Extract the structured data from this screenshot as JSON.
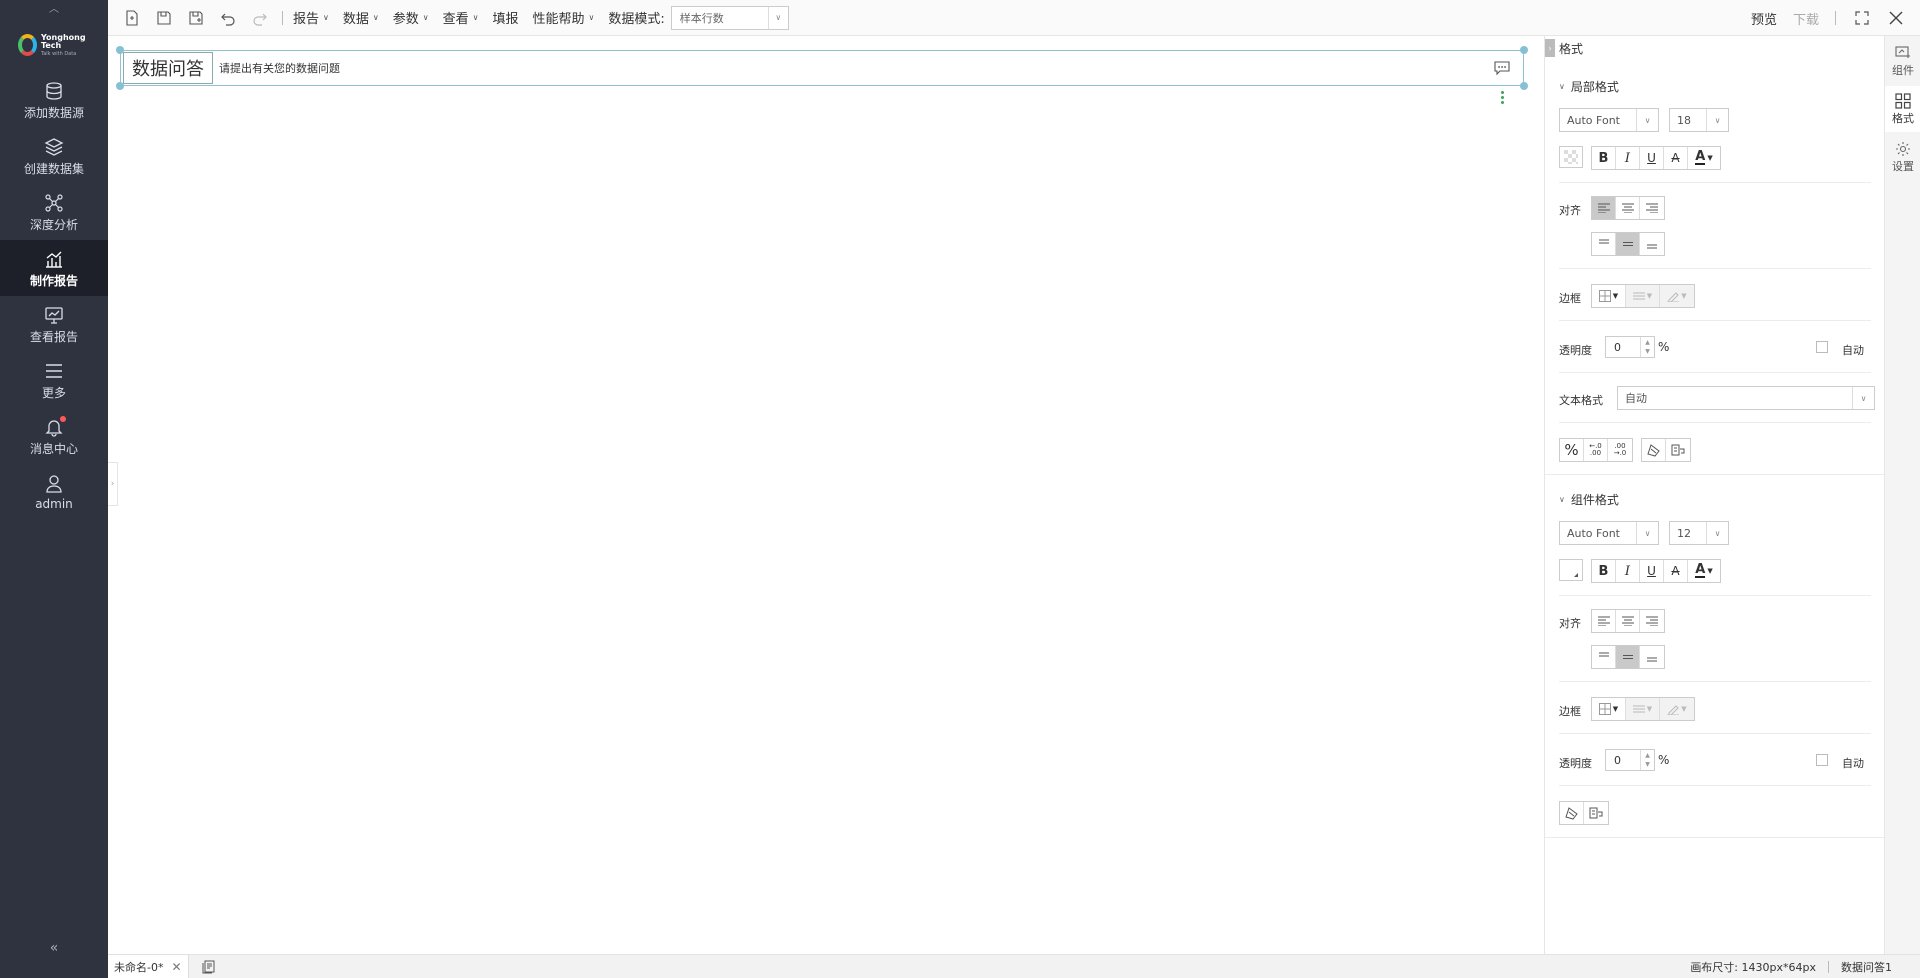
{
  "nav": {
    "brand_name": "Yonghong Tech",
    "brand_tagline": "Talk with Data",
    "items": [
      {
        "label": "添加数据源",
        "icon": "database-icon"
      },
      {
        "label": "创建数据集",
        "icon": "layers-icon"
      },
      {
        "label": "深度分析",
        "icon": "network-icon"
      },
      {
        "label": "制作报告",
        "icon": "bar-chart-icon"
      },
      {
        "label": "查看报告",
        "icon": "monitor-chart-icon"
      },
      {
        "label": "更多",
        "icon": "menu-icon"
      },
      {
        "label": "消息中心",
        "icon": "bell-icon"
      },
      {
        "label": "admin",
        "icon": "user-icon"
      }
    ],
    "active_index": 3
  },
  "toolbar": {
    "menus": [
      "报告",
      "数据",
      "参数",
      "查看"
    ],
    "fill_label": "填报",
    "perf_help": "性能帮助",
    "data_mode_label": "数据模式:",
    "data_mode_value": "样本行数",
    "preview": "预览",
    "download": "下载"
  },
  "canvas": {
    "qa_label": "数据问答",
    "qa_placeholder": "请提出有关您的数据问题"
  },
  "status": {
    "tab_name": "未命名-0*",
    "canvas_size": "画布尺寸: 1430px*64px",
    "selected": "数据问答1"
  },
  "panel": {
    "title": "格式",
    "local_format": {
      "title": "局部格式",
      "font": "Auto Font",
      "size": "18",
      "align_label": "对齐",
      "border_label": "边框",
      "opacity_label": "透明度",
      "opacity_value": "0",
      "percent": "%",
      "auto_label": "自动",
      "text_format_label": "文本格式",
      "text_format_value": "自动"
    },
    "component_format": {
      "title": "组件格式",
      "font": "Auto Font",
      "size": "12",
      "align_label": "对齐",
      "border_label": "边框",
      "opacity_label": "透明度",
      "opacity_value": "0",
      "percent": "%",
      "auto_label": "自动"
    }
  },
  "rail": {
    "items": [
      "组件",
      "格式",
      "设置"
    ],
    "active_index": 1
  }
}
